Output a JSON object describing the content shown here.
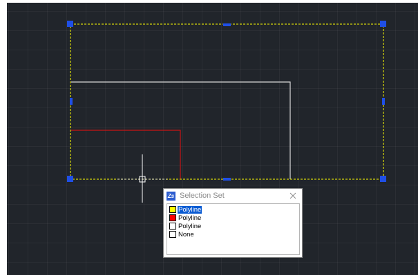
{
  "popup": {
    "title": "Selection Set",
    "app_icon": "drawing-app-icon",
    "close_icon": "close-icon",
    "items": [
      {
        "label": "Polyline",
        "swatch": "#ffff00",
        "selected": true
      },
      {
        "label": "Polyline",
        "swatch": "#ff0000",
        "selected": false
      },
      {
        "label": "Polyline",
        "swatch": "#ffffff",
        "selected": false
      },
      {
        "label": "None",
        "swatch": "#ffffff",
        "selected": false
      }
    ]
  },
  "colors": {
    "canvas_background": "#21252b",
    "selection_box": "#ffff00",
    "grip": "#1f4fe6",
    "polyline_white": "#d9d9d9",
    "polyline_red": "#c81414",
    "crosshair": "#ffffff",
    "dashed_segment": "#8fa8ff"
  }
}
